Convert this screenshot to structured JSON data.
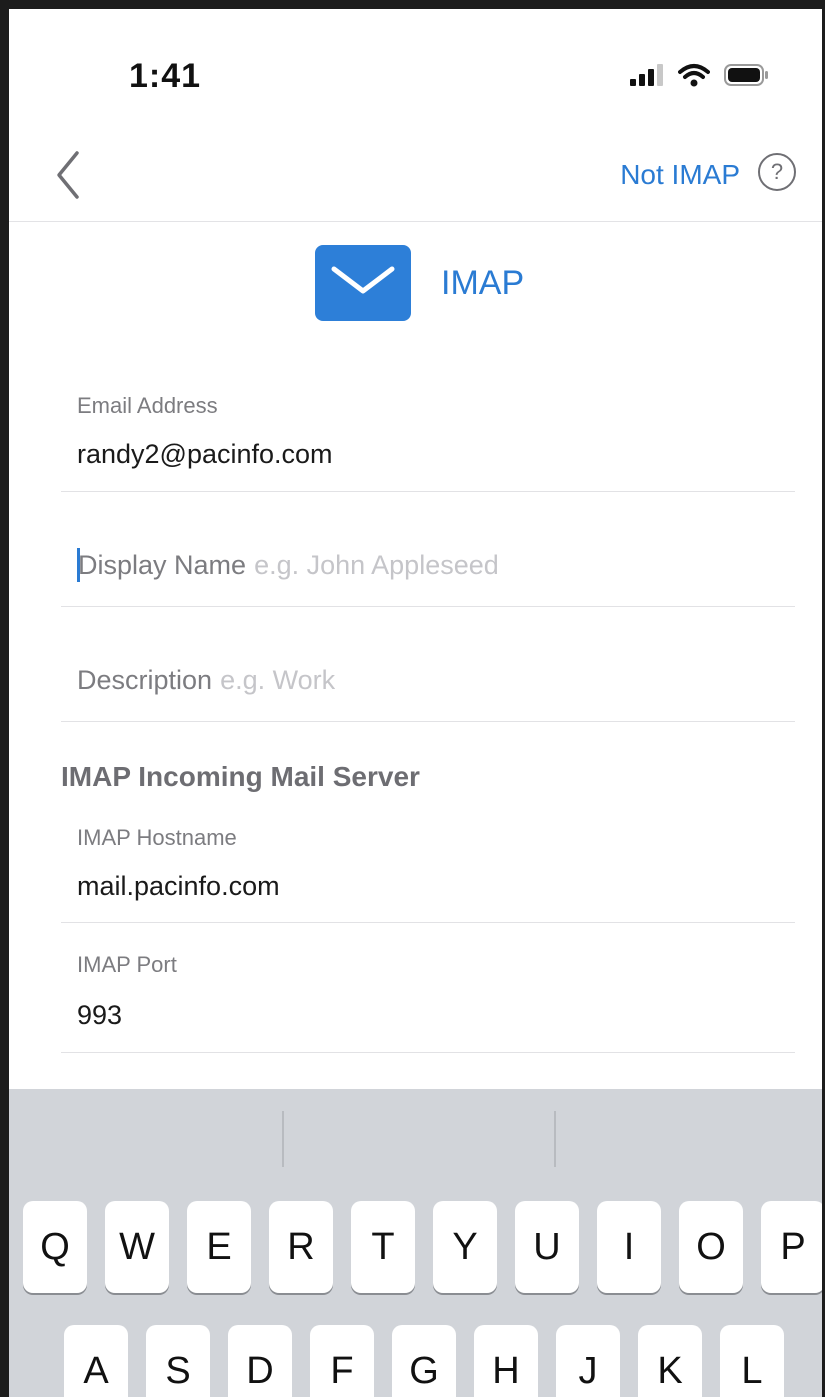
{
  "status": {
    "time": "1:41"
  },
  "nav": {
    "not_imap": "Not IMAP",
    "help_symbol": "?"
  },
  "header": {
    "title": "IMAP"
  },
  "fields": {
    "email": {
      "label": "Email Address",
      "value": "randy2@pacinfo.com"
    },
    "display_name": {
      "label": "Display Name",
      "placeholder": "e.g. John Appleseed"
    },
    "description": {
      "label": "Description",
      "placeholder": "e.g. Work"
    }
  },
  "section": {
    "title": "IMAP Incoming Mail Server"
  },
  "server": {
    "hostname": {
      "label": "IMAP Hostname",
      "value": "mail.pacinfo.com"
    },
    "port": {
      "label": "IMAP Port",
      "value": "993"
    }
  },
  "keyboard": {
    "row1": [
      "Q",
      "W",
      "E",
      "R",
      "T",
      "Y",
      "U",
      "I",
      "O",
      "P"
    ],
    "row2": [
      "A",
      "S",
      "D",
      "F",
      "G",
      "H",
      "J",
      "K",
      "L"
    ]
  },
  "colors": {
    "accent": "#2a7bd3",
    "mail_icon": "#2d7fd8",
    "keyboard_bg": "#d1d4d9"
  },
  "icons": [
    "cellular-signal-icon",
    "wifi-icon",
    "battery-icon",
    "back-chevron-icon",
    "help-icon",
    "mail-envelope-icon"
  ]
}
